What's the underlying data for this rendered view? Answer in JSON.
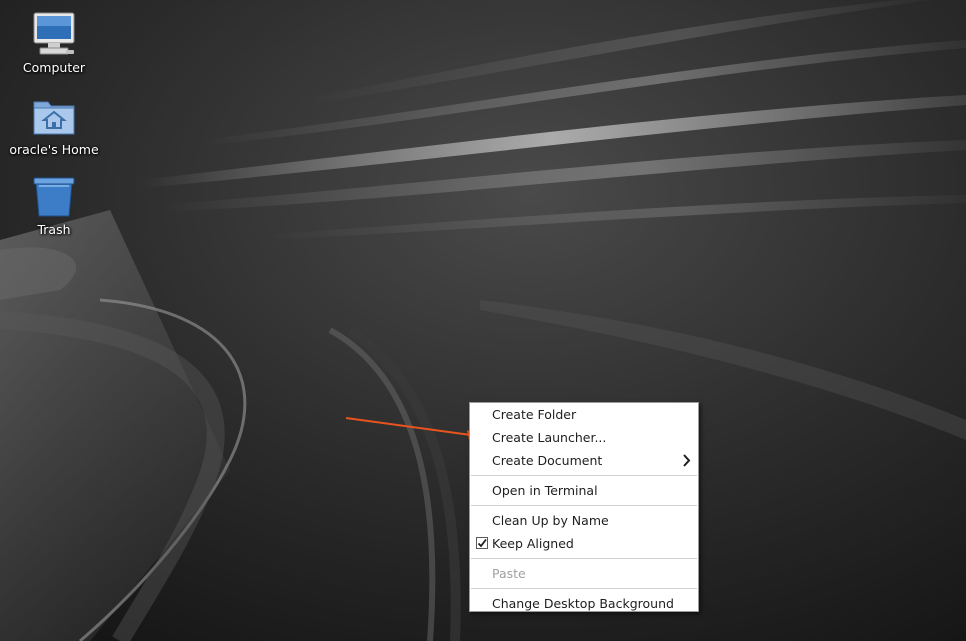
{
  "desktop": {
    "icons": [
      {
        "label": "Computer",
        "icon": "computer-icon"
      },
      {
        "label": "oracle's Home",
        "icon": "home-folder-icon"
      },
      {
        "label": "Trash",
        "icon": "trash-icon"
      }
    ]
  },
  "context_menu": {
    "items": [
      {
        "label": "Create Folder"
      },
      {
        "label": "Create Launcher..."
      },
      {
        "label": "Create Document",
        "submenu": true
      },
      {
        "label": "Open in Terminal"
      },
      {
        "label": "Clean Up by Name"
      },
      {
        "label": "Keep Aligned",
        "checked": true
      },
      {
        "label": "Paste",
        "disabled": true
      },
      {
        "label": "Change Desktop Background"
      }
    ]
  },
  "colors": {
    "annotation_arrow": "#e8541e",
    "menu_background": "#ffffff",
    "disabled_text": "#a0a0a0"
  }
}
